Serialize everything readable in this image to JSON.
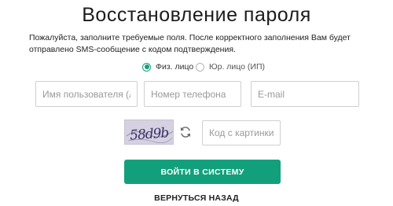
{
  "page": {
    "title": "Восстановление пароля",
    "notice": "Пожалуйста, заполните требуемые поля. После корректного заполнения Вам будет отправлено SMS-сообщение с кодом подтверждения."
  },
  "account_type": {
    "options": [
      {
        "label": "Физ. лицо",
        "selected": true
      },
      {
        "label": "Юр. лицо (ИП)",
        "selected": false
      }
    ]
  },
  "fields": {
    "username": {
      "placeholder": "Имя пользователя (логин)",
      "value": ""
    },
    "phone": {
      "placeholder": "Номер телефона",
      "value": ""
    },
    "email": {
      "placeholder": "E-mail",
      "value": ""
    },
    "captcha_code": {
      "placeholder": "Код с картинки",
      "value": ""
    }
  },
  "captcha": {
    "text": "58d9b"
  },
  "actions": {
    "submit_label": "Войти в систему",
    "back_label": "Вернуться назад"
  },
  "colors": {
    "accent": "#12a07c",
    "captcha_bg": "#d5d1e0",
    "captcha_ink": "#3b2f66"
  },
  "icons": {
    "refresh": "refresh-icon"
  }
}
